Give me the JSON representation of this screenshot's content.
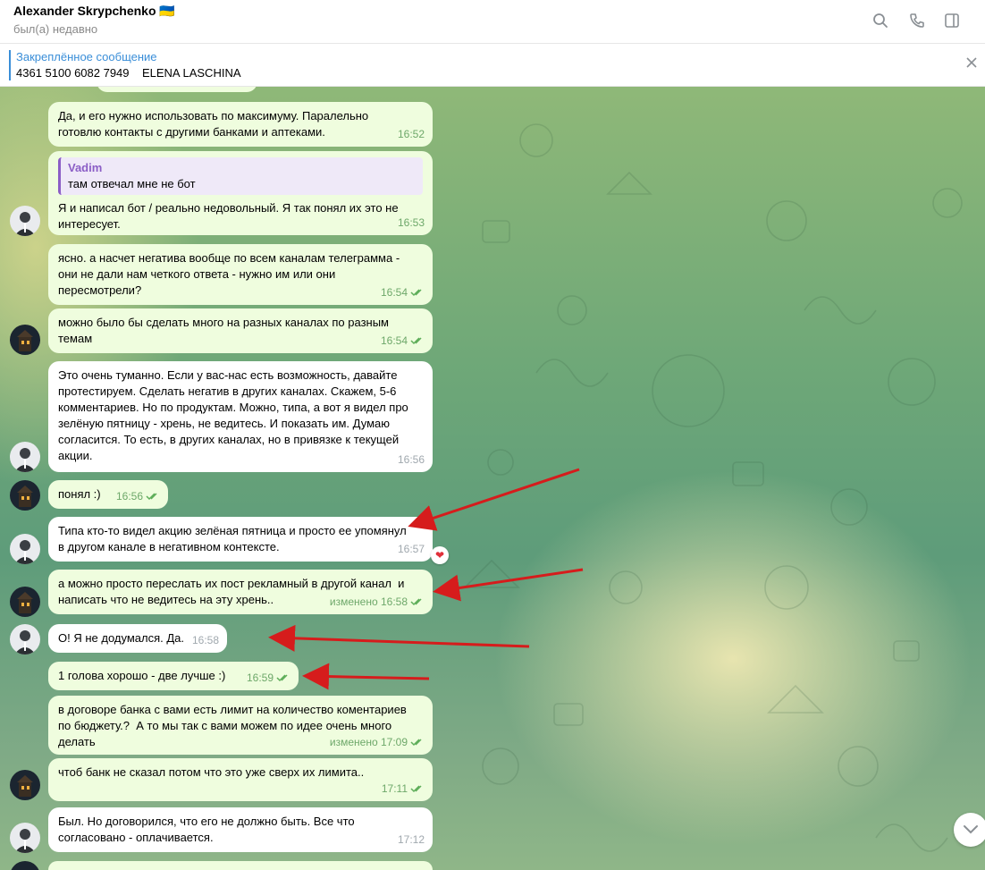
{
  "header": {
    "name": "Alexander Skrypchenko 🇺🇦",
    "status": "был(а) недавно"
  },
  "pinned": {
    "title": "Закреплённое сообщение",
    "text": "4361 5100 6082 7949    ELENA LASCHINA"
  },
  "messages": [
    {
      "text": "Да, и его нужно использовать по максимуму. Паралельно\nготовлю контакты с другими банками и аптеками.",
      "time": "16:52"
    },
    {
      "reply_name": "Vadim",
      "reply_text": "там отвечал мне не бот",
      "text": "Я и написал бот / реально недовольный. Я так понял их это не\nинтересует.",
      "time": "16:53"
    },
    {
      "text": "ясно. а насчет негатива вообще по всем каналам телеграмма -\nони не дали нам четкого ответа - нужно им или они\nпересмотрели?",
      "time": "16:54"
    },
    {
      "text": "можно было бы сделать много на разных каналах по разным\nтемам",
      "time": "16:54"
    },
    {
      "text": "Это очень туманно. Если у вас-нас есть возможность, давайте\nпротестируем. Сделать негатив в других каналах. Скажем, 5-6\nкомментариев. Но по продуктам. Можно, типа, а вот я видел про\nзелёную пятницу - хрень, не ведитесь. И показать им. Думаю\nсогласится. То есть, в других каналах, но в привязке к текущей\nакции.",
      "time": "16:56"
    },
    {
      "text": "понял :)",
      "time": "16:56"
    },
    {
      "text": "Типа кто-то видел акцию зелёная пятница и просто ее упомянул\nв другом канале в негативном контексте.",
      "time": "16:57",
      "reaction": "❤"
    },
    {
      "text": "а можно просто переслать их пост рекламный в другой канал  и\nнаписать что не ведитесь на эту хрень..",
      "time": "изменено 16:58"
    },
    {
      "text": "О! Я не додумался. Да.",
      "time": "16:58"
    },
    {
      "text": "1 голова хорошо - две лучше :)",
      "time": "16:59"
    },
    {
      "text": "в договоре банка с вами есть лимит на количество коментариев\nпо бюджету.?  А то мы так с вами можем по идее очень много\nделать",
      "time": "изменено 17:09"
    },
    {
      "text": "чтоб банк не сказал потом что это уже сверх их лимита..",
      "time": "17:11"
    },
    {
      "text": "Был. Но договорился, что его не должно быть. Все что\nсогласовано - оплачивается.",
      "time": "17:12"
    }
  ],
  "icons": {
    "search": "search-icon",
    "call": "phone-icon",
    "sidebar": "sidebar-toggle-icon",
    "close": "close-icon",
    "scroll": "chevron-down-icon"
  },
  "colors": {
    "outgoing_bubble": "#effdde",
    "incoming_bubble": "#ffffff",
    "accent": "#3a8ed8",
    "annotation_arrow": "#d61c1c"
  }
}
